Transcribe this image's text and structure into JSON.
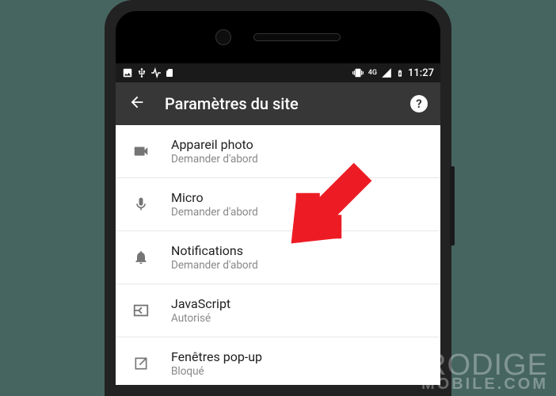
{
  "status_bar": {
    "time": "11:27",
    "data_label": "4G"
  },
  "header": {
    "title": "Paramètres du site"
  },
  "settings": [
    {
      "icon": "camera-icon",
      "title": "Appareil photo",
      "subtitle": "Demander d'abord"
    },
    {
      "icon": "mic-icon",
      "title": "Micro",
      "subtitle": "Demander d'abord"
    },
    {
      "icon": "bell-icon",
      "title": "Notifications",
      "subtitle": "Demander d'abord"
    },
    {
      "icon": "javascript-icon",
      "title": "JavaScript",
      "subtitle": "Autorisé"
    },
    {
      "icon": "popup-icon",
      "title": "Fenêtres pop-up",
      "subtitle": "Bloqué"
    }
  ],
  "watermark": {
    "line1": "PRODIGE",
    "line2": "MOBILE.COM"
  }
}
